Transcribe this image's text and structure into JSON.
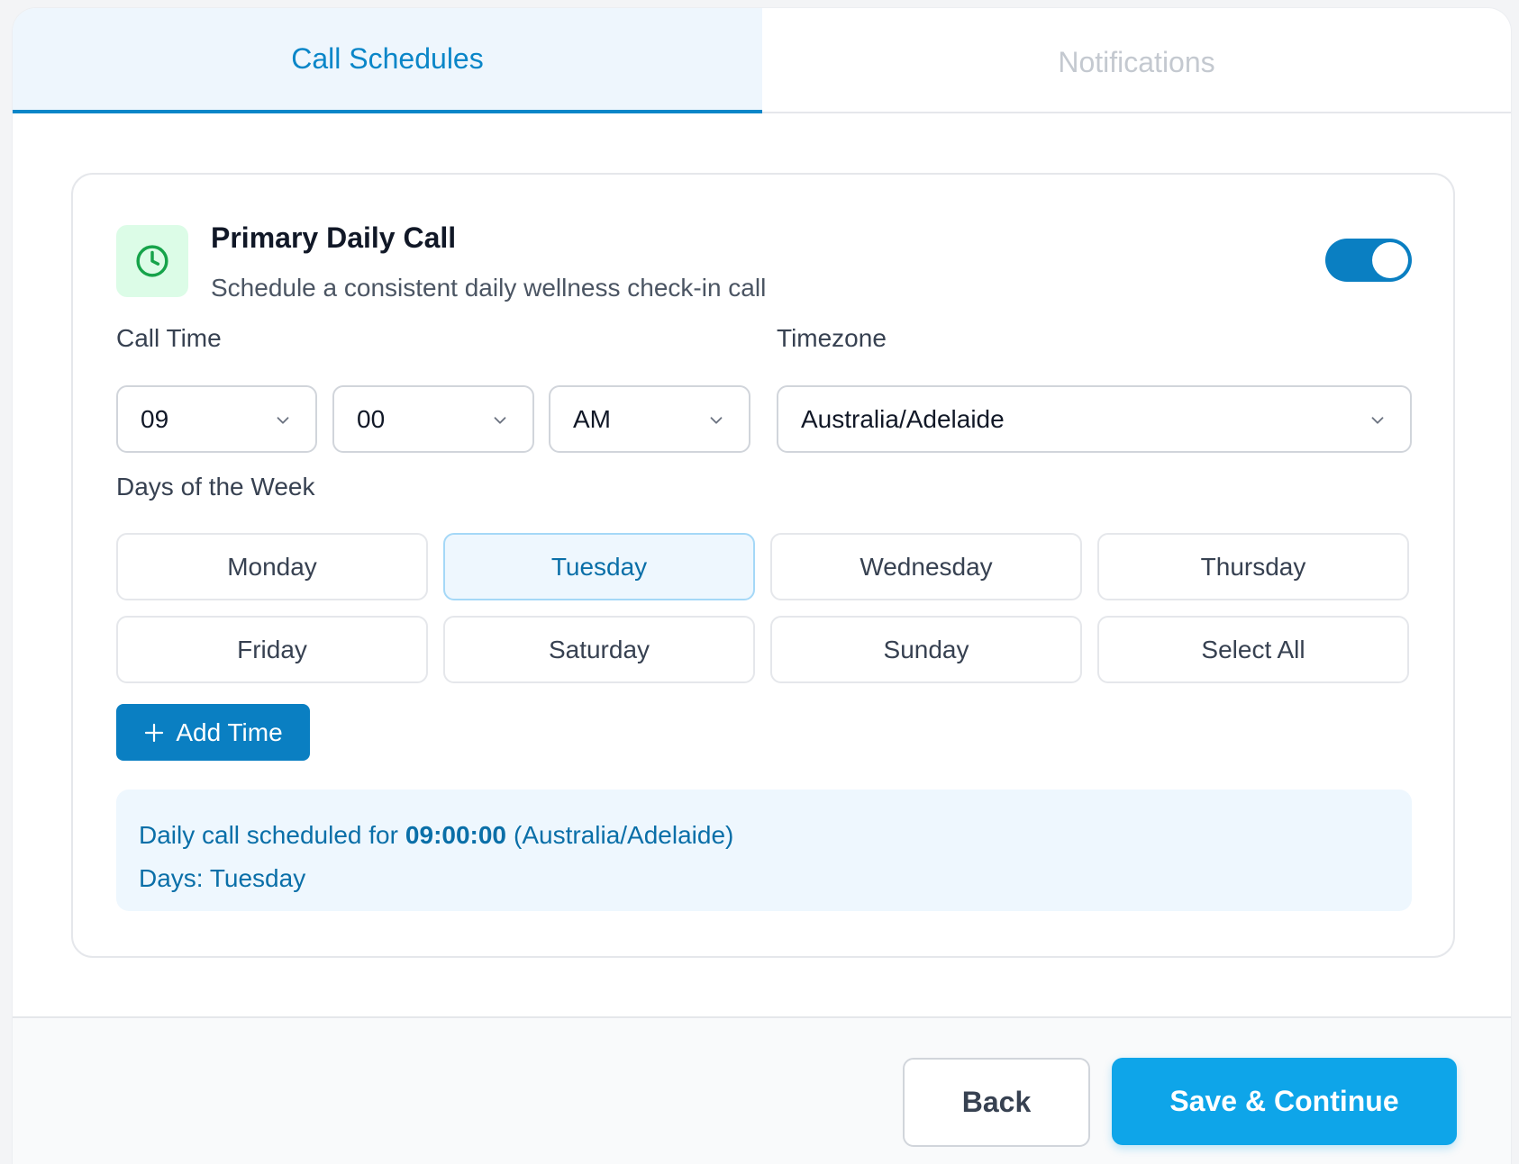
{
  "tabs": {
    "active": "Call Schedules",
    "inactive": "Notifications"
  },
  "card": {
    "title": "Primary Daily Call",
    "subtitle": "Schedule a consistent daily wellness check-in call",
    "enabled": true
  },
  "call_time": {
    "label": "Call Time",
    "hour": "09",
    "minute": "00",
    "period": "AM"
  },
  "timezone": {
    "label": "Timezone",
    "value": "Australia/Adelaide"
  },
  "days": {
    "label": "Days of the Week",
    "items": [
      "Monday",
      "Tuesday",
      "Wednesday",
      "Thursday",
      "Friday",
      "Saturday",
      "Sunday",
      "Select All"
    ],
    "selected": [
      "Tuesday"
    ]
  },
  "add_time": {
    "label": "Add Time"
  },
  "summary": {
    "prefix": "Daily call scheduled for",
    "time": "09:00:00",
    "timezone": "(Australia/Adelaide)",
    "days_line": "Days: Tuesday"
  },
  "footer": {
    "back": "Back",
    "save": "Save & Continue"
  },
  "colors": {
    "accent": "#0a7fc2",
    "primary_button": "#0ea5e9",
    "clock_bg": "#dcfce7",
    "clock_icon": "#16a34a"
  }
}
